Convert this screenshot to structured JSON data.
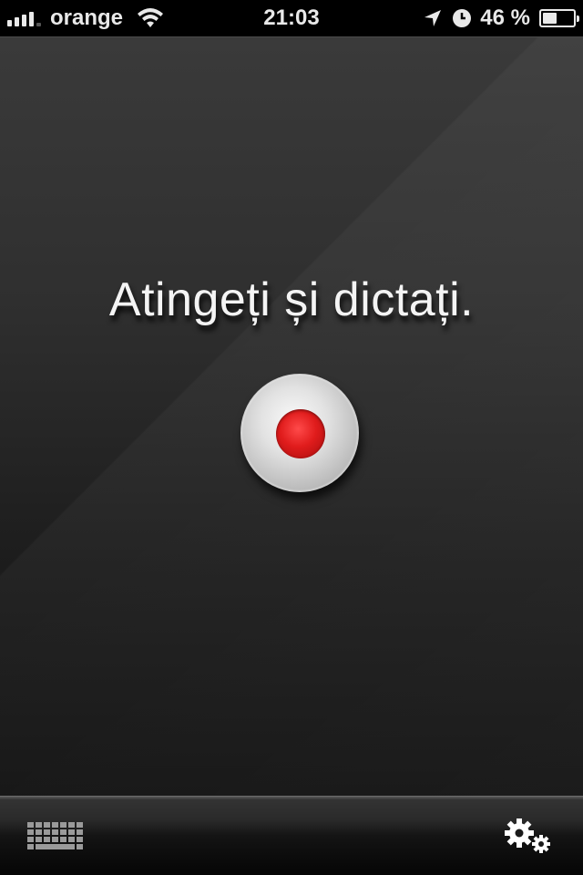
{
  "status_bar": {
    "carrier": "orange",
    "time": "21:03",
    "battery_percent_label": "46 %",
    "battery_level": 0.46,
    "signal_bars": 4,
    "icons": [
      "signal-icon",
      "wifi-icon",
      "location-arrow-icon",
      "alarm-clock-icon",
      "battery-icon"
    ]
  },
  "main": {
    "prompt": "Atingeți și dictați.",
    "record_button_icon": "record-icon",
    "accent_color": "#e01c1c"
  },
  "toolbar": {
    "keyboard_icon": "keyboard-icon",
    "settings_icon": "gears-icon"
  }
}
